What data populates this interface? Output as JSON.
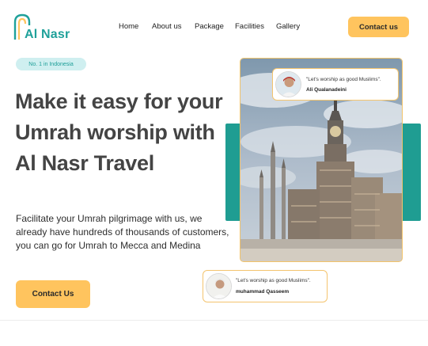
{
  "brand": {
    "name": "Al Nasr",
    "logo_icon": "arch-logo-icon",
    "color": "#1fa19a"
  },
  "nav": {
    "items": [
      {
        "label": "Home"
      },
      {
        "label": "About us"
      },
      {
        "label": "Package"
      },
      {
        "label": "Facilities"
      },
      {
        "label": "Gallery"
      }
    ],
    "cta_label": "Contact us"
  },
  "hero": {
    "badge": "No. 1 in Indonesia",
    "headline": "Make it easy for your Umrah worship with Al Nasr Travel",
    "subtext": "Facilitate your Umrah pilgrimage with us, we already have hundreds of thousands of customers, you can go for Umrah to Mecca and Medina",
    "cta_label": "Contact Us"
  },
  "testimonials": [
    {
      "quote": "\"Let's worship as good Muslims\".",
      "name": "Ali Qualanadeini"
    },
    {
      "quote": "\"Let's worship as good Muslims\".",
      "name": "muhammad Qasseem"
    }
  ],
  "colors": {
    "accent": "#ffc45e",
    "teal": "#1f9d92",
    "badge_bg": "#cfeff0"
  }
}
